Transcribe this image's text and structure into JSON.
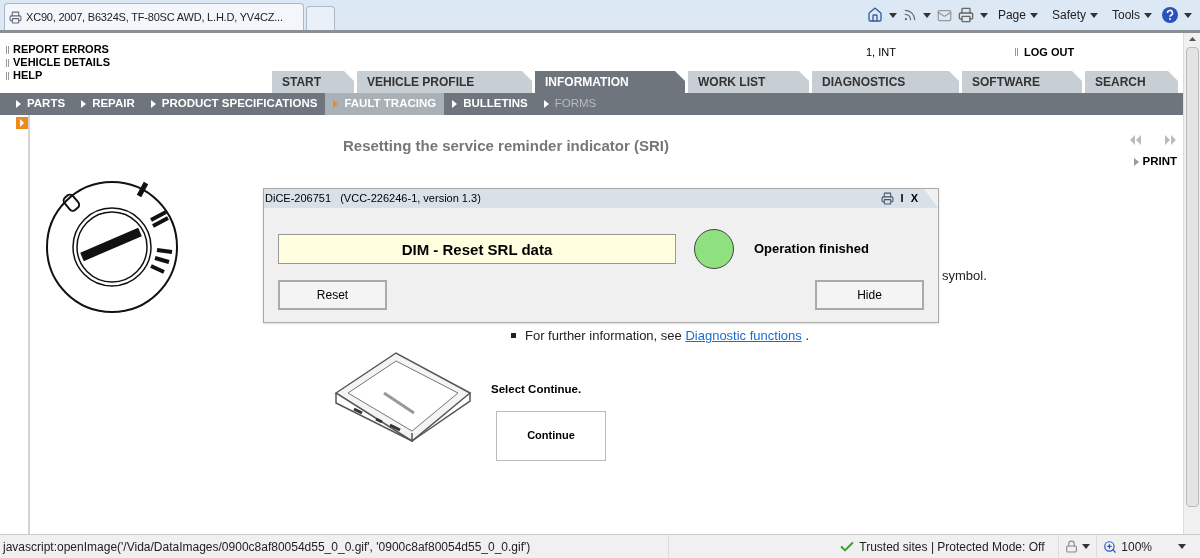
{
  "browser": {
    "tab_title": "XC90, 2007, B6324S, TF-80SC AWD, L.H.D, YV4CZ...",
    "menus": [
      "Page",
      "Safety",
      "Tools"
    ]
  },
  "header": {
    "links": [
      "REPORT ERRORS",
      "VEHICLE DETAILS",
      "HELP"
    ],
    "user": "1, INT",
    "logout": "LOG OUT"
  },
  "main_tabs": [
    {
      "label": "START",
      "selected": false
    },
    {
      "label": "VEHICLE PROFILE",
      "selected": false
    },
    {
      "label": "INFORMATION",
      "selected": true
    },
    {
      "label": "WORK LIST",
      "selected": false
    },
    {
      "label": "DIAGNOSTICS",
      "selected": false
    },
    {
      "label": "SOFTWARE",
      "selected": false
    },
    {
      "label": "SEARCH",
      "selected": false
    }
  ],
  "sub_nav": [
    {
      "label": "PARTS",
      "selected": false,
      "disabled": false
    },
    {
      "label": "REPAIR",
      "selected": false,
      "disabled": false
    },
    {
      "label": "PRODUCT SPECIFICATIONS",
      "selected": false,
      "disabled": false
    },
    {
      "label": "FAULT TRACING",
      "selected": true,
      "disabled": false
    },
    {
      "label": "BULLETINS",
      "selected": false,
      "disabled": false
    },
    {
      "label": "FORMS",
      "selected": false,
      "disabled": true
    }
  ],
  "content": {
    "title": "Resetting the service reminder indicator (SRI)",
    "print": "PRINT",
    "step_tail": "symbol.",
    "bullet_text": "For further information, see",
    "bullet_link": "Diagnostic functions",
    "bullet_end": ".",
    "instruction": "Select Continue.",
    "continue_button": "Continue"
  },
  "dialog": {
    "title": "DiCE-206751   (VCC-226246-1, version 1.3)",
    "controls": [
      "I",
      "X"
    ],
    "operation": "DIM - Reset SRL data",
    "status": "Operation finished",
    "buttons": [
      "Reset",
      "Hide"
    ]
  },
  "status_bar": {
    "url": "javascript:openImage('/Vida/DataImages/0900c8af80054d55_0_0.gif', '0900c8af80054d55_0_0.gif')",
    "zone": "Trusted sites | Protected Mode: Off",
    "zoom": "100%"
  }
}
